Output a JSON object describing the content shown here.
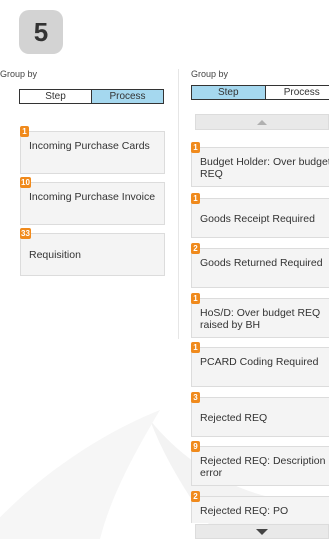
{
  "step_number": "5",
  "left": {
    "group_by_label": "Group by",
    "toggle": {
      "step_label": "Step",
      "process_label": "Process",
      "active": "process"
    },
    "items": [
      {
        "count": "1",
        "label": "Incoming Purchase Cards"
      },
      {
        "count": "10",
        "label": "Incoming Purchase Invoice"
      },
      {
        "count": "33",
        "label": "Requisition"
      }
    ]
  },
  "right": {
    "group_by_label": "Group by",
    "toggle": {
      "step_label": "Step",
      "process_label": "Process",
      "active": "step"
    },
    "items": [
      {
        "count": "1",
        "label": "Budget Holder: Over budget REQ"
      },
      {
        "count": "1",
        "label": "Goods Receipt Required"
      },
      {
        "count": "2",
        "label": "Goods Returned Required"
      },
      {
        "count": "1",
        "label": "HoS/D: Over budget REQ raised by BH"
      },
      {
        "count": "1",
        "label": "PCARD Coding Required"
      },
      {
        "count": "3",
        "label": "Rejected REQ"
      },
      {
        "count": "9",
        "label": "Rejected REQ: Description error"
      },
      {
        "count": "2",
        "label": "Rejected REQ: PO"
      }
    ]
  },
  "colors": {
    "badge_orange": "#f08a1c",
    "active_tab": "#a5d8ef",
    "card_bg": "#f4f4f4"
  }
}
